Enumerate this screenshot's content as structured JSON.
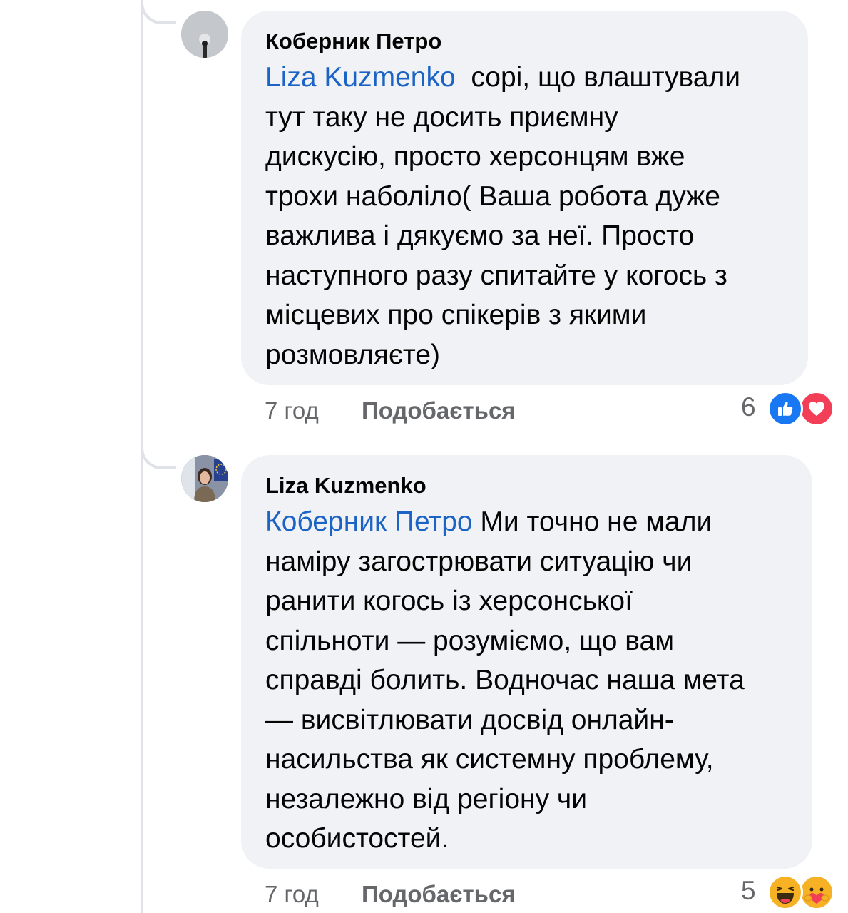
{
  "comments": [
    {
      "author": "Коберник Петро",
      "mention": "Liza Kuzmenko",
      "text_lines": [
        "сорі, що влаштували",
        "тут таку не досить приємну",
        "дискусію, просто херсонцям вже",
        "трохи наболіло( Ваша робота дуже",
        "важлива і дякуємо за неї. Просто",
        "наступного разу спитайте у когось з",
        "місцевих про спікерів з якими",
        "розмовляєте)"
      ],
      "time": "7 год",
      "like_label": "Подобається",
      "reaction_count": "6",
      "reactions": [
        "like-icon",
        "love-icon"
      ]
    },
    {
      "author": "Liza Kuzmenko",
      "mention": "Коберник Петро",
      "text_lines": [
        "Ми точно не мали",
        "наміру загострювати ситуацію чи",
        "ранити когось із херсонської",
        "спільноти — розуміємо, що вам",
        "справді болить. Водночас наша мета",
        "— висвітлювати досвід онлайн-",
        "насильства як системну проблему,",
        "незалежно від регіону чи",
        "особистостей."
      ],
      "time": "7 год",
      "like_label": "Подобається",
      "reaction_count": "5",
      "reactions": [
        "haha-icon",
        "care-icon"
      ]
    }
  ],
  "colors": {
    "bubble": "#f0f2f5",
    "mention": "#1b63c5",
    "meta": "#65676b",
    "like": "#1877f2",
    "love": "#f33e58",
    "haha": "#f7b125"
  }
}
